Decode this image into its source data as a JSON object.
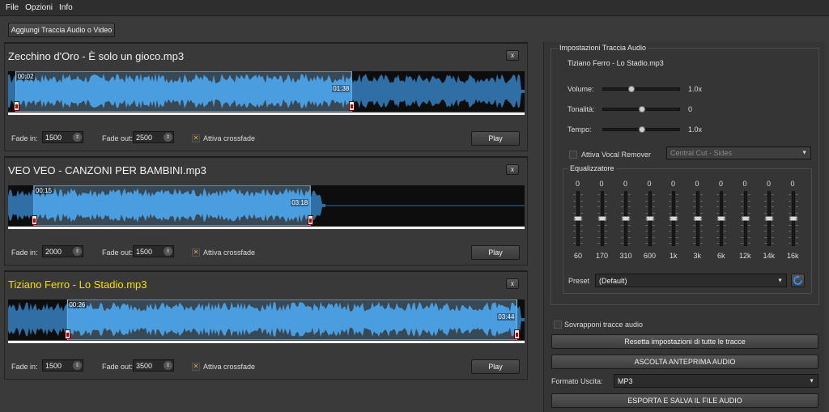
{
  "menu": {
    "items": [
      "File",
      "Opzioni",
      "Info"
    ]
  },
  "toolbar": {
    "add_track_label": "Aggiungi Traccia Audio o Video"
  },
  "tracks": [
    {
      "title": "Zecchino d'Oro - È solo un gioco.mp3",
      "active": false,
      "start_time": "00:02",
      "end_time": "01:38",
      "fade_in_label": "Fade in:",
      "fade_in": "1500",
      "fade_out_label": "Fade out:",
      "fade_out": "2500",
      "crossfade_label": "Attiva crossfade",
      "crossfade_checked": true,
      "play_label": "Play",
      "close_label": "x",
      "selection": [
        0.015,
        0.665
      ],
      "audio_end": 1.0
    },
    {
      "title": "VEO VEO - CANZONI PER BAMBINI.mp3",
      "active": false,
      "start_time": "00:15",
      "end_time": "03:18",
      "fade_in_label": "Fade in:",
      "fade_in": "2000",
      "fade_out_label": "Fade out:",
      "fade_out": "1500",
      "crossfade_label": "Attiva crossfade",
      "crossfade_checked": true,
      "play_label": "Play",
      "close_label": "x",
      "selection": [
        0.05,
        0.585
      ],
      "audio_end": 0.615
    },
    {
      "title": "Tiziano Ferro - Lo Stadio.mp3",
      "active": true,
      "start_time": "00:26",
      "end_time": "03:44",
      "fade_in_label": "Fade in:",
      "fade_in": "1500",
      "fade_out_label": "Fade out:",
      "fade_out": "3500",
      "crossfade_label": "Attiva crossfade",
      "crossfade_checked": true,
      "play_label": "Play",
      "close_label": "x",
      "selection": [
        0.115,
        0.985
      ],
      "audio_end": 1.0
    }
  ],
  "settings": {
    "group_title": "Impostazioni Traccia Audio",
    "track_name": "Tiziano Ferro - Lo Stadio.mp3",
    "volume": {
      "label": "Volume:",
      "value": "1.0x",
      "level": 0.35
    },
    "pitch": {
      "label": "Tonalità:",
      "value": "0",
      "level": 0.5
    },
    "tempo": {
      "label": "Tempo:",
      "value": "1.0x",
      "level": 0.5
    },
    "vocal_remover": {
      "label": "Attiva Vocal Remover",
      "checked": false,
      "mode": "Central Cut - Sides"
    },
    "equalizer": {
      "title": "Equalizzatore",
      "bands": [
        {
          "freq": "60",
          "gain": "0"
        },
        {
          "freq": "170",
          "gain": "0"
        },
        {
          "freq": "310",
          "gain": "0"
        },
        {
          "freq": "600",
          "gain": "0"
        },
        {
          "freq": "1k",
          "gain": "0"
        },
        {
          "freq": "3k",
          "gain": "0"
        },
        {
          "freq": "6k",
          "gain": "0"
        },
        {
          "freq": "12k",
          "gain": "0"
        },
        {
          "freq": "14k",
          "gain": "0"
        },
        {
          "freq": "16k",
          "gain": "0"
        }
      ],
      "preset_label": "Preset",
      "preset_value": "(Default)"
    }
  },
  "overlap": {
    "label": "Sovrapponi tracce audio",
    "checked": false
  },
  "reset_label": "Resetta impostazioni di tutte le tracce",
  "preview_label": "ASCOLTA ANTEPRIMA AUDIO",
  "output": {
    "label": "Formato Uscita:",
    "value": "MP3"
  },
  "export_label": "ESPORTA E SALVA IL FILE AUDIO",
  "colors": {
    "wave_selected": "#4a9ee0",
    "wave_unselected": "#2f6fa6",
    "title_active": "#f3e100"
  }
}
